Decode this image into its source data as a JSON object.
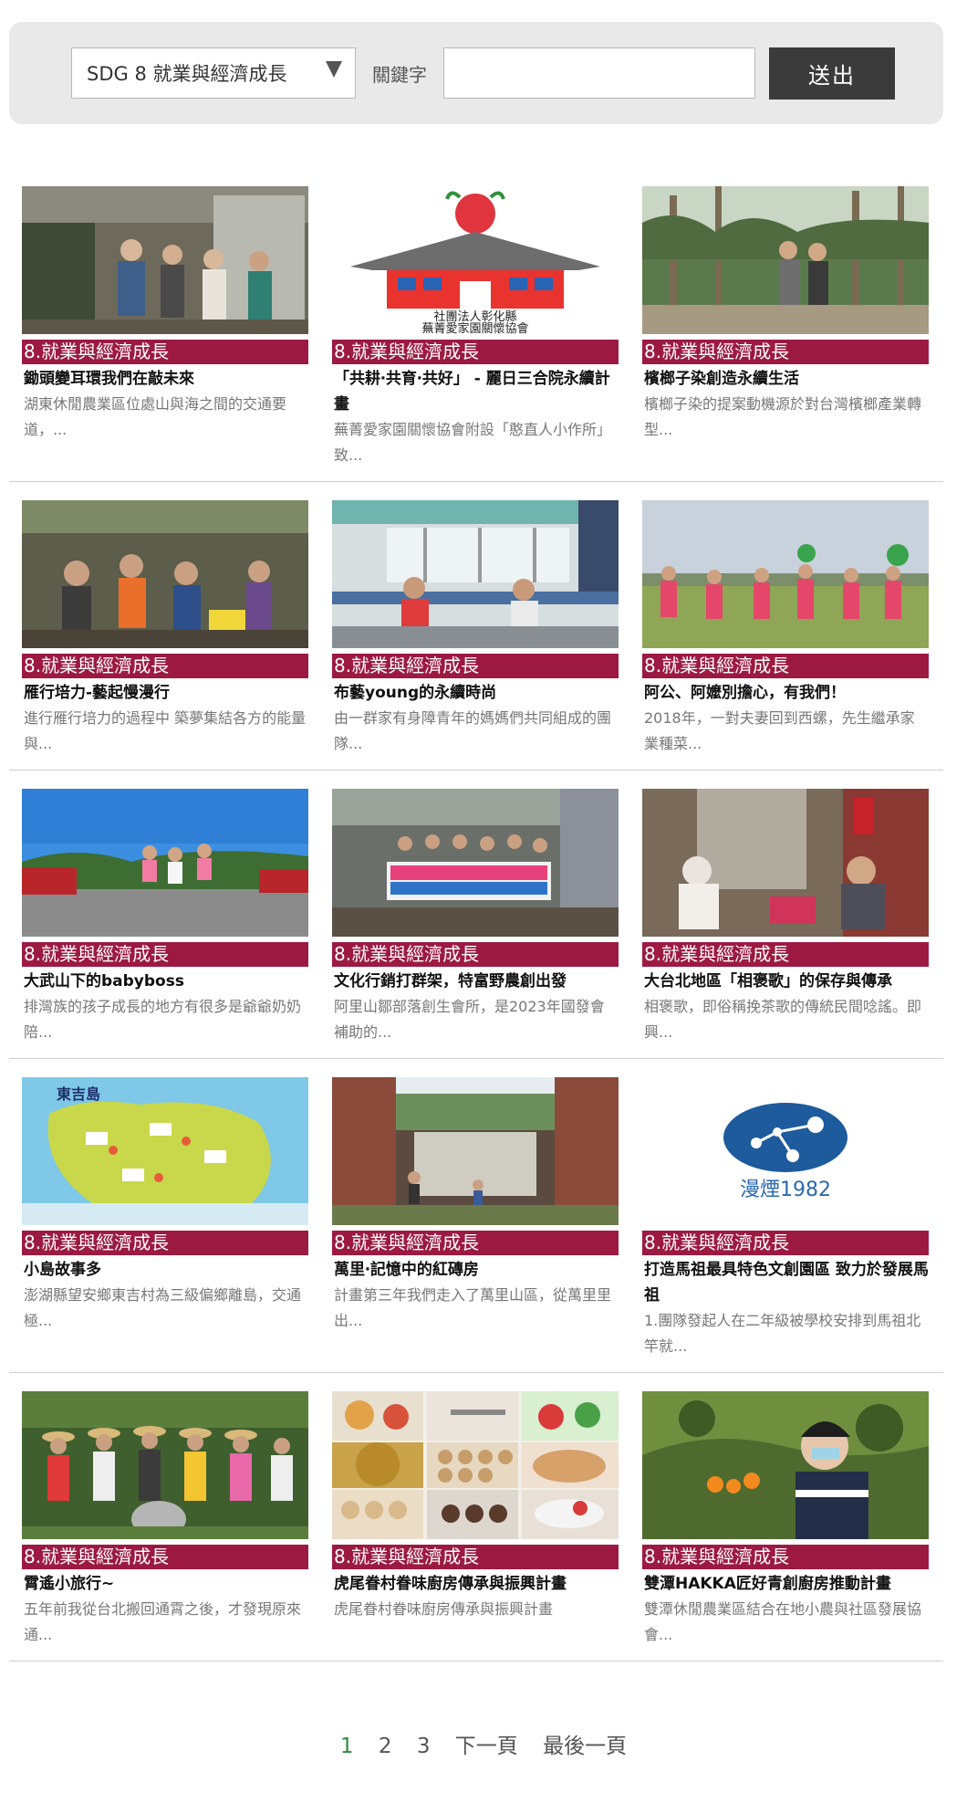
{
  "search": {
    "selected_option": "SDG 8 就業與經濟成長",
    "keyword_label": "關鍵字",
    "keyword_value": "",
    "submit_label": "送出"
  },
  "tag_color": "#9c1a42",
  "rows": [
    [
      {
        "tag": "8.就業與經濟成長",
        "title": "鋤頭變耳環我們在敲未來",
        "desc": "湖東休閒農業區位處山與海之間的交通要道，..."
      },
      {
        "tag": "8.就業與經濟成長",
        "title": "「共耕‧共育‧共好」 - 麗日三合院永續計畫",
        "desc": "蕪菁愛家園關懷協會附設「憨直人小作所」致..."
      },
      {
        "tag": "8.就業與經濟成長",
        "title": "檳榔子染創造永續生活",
        "desc": "檳榔子染的提案動機源於對台灣檳榔產業轉型..."
      }
    ],
    [
      {
        "tag": "8.就業與經濟成長",
        "title": "雁行培力-藝起慢漫行",
        "desc": "進行雁行培力的過程中 築夢集結各方的能量與..."
      },
      {
        "tag": "8.就業與經濟成長",
        "title": "布藝young的永續時尚",
        "desc": "由一群家有身障青年的媽媽們共同組成的團隊..."
      },
      {
        "tag": "8.就業與經濟成長",
        "title": "阿公、阿嬤別擔心，有我們！",
        "desc": "2018年，一對夫妻回到西螺，先生繼承家業種菜..."
      }
    ],
    [
      {
        "tag": "8.就業與經濟成長",
        "title": "大武山下的babyboss",
        "desc": "排灣族的孩子成長的地方有很多是爺爺奶奶陪..."
      },
      {
        "tag": "8.就業與經濟成長",
        "title": "文化行銷打群架，特富野農創出發",
        "desc": "阿里山鄒部落創生會所，是2023年國發會補助的..."
      },
      {
        "tag": "8.就業與經濟成長",
        "title": "大台北地區「相褒歌」的保存與傳承",
        "desc": "相褒歌，即俗稱挽茶歌的傳統民間唸謠。即興..."
      }
    ],
    [
      {
        "tag": "8.就業與經濟成長",
        "title": "小島故事多",
        "desc": "澎湖縣望安鄉東吉村為三級偏鄉離島，交通極..."
      },
      {
        "tag": "8.就業與經濟成長",
        "title": "萬里‧記憶中的紅磚房",
        "desc": "計畫第三年我們走入了萬里山區，從萬里里出..."
      },
      {
        "tag": "8.就業與經濟成長",
        "title": "打造馬祖最具特色文創園區 致力於發展馬祖",
        "desc": "1.團隊發起人在二年級被學校安排到馬祖北竿就..."
      }
    ],
    [
      {
        "tag": "8.就業與經濟成長",
        "title": "霄遙小旅行~",
        "desc": "五年前我從台北搬回通霄之後，才發現原來通..."
      },
      {
        "tag": "8.就業與經濟成長",
        "title": "虎尾眷村眷味廚房傳承與振興計畫",
        "desc": "虎尾眷村眷味廚房傳承與振興計畫"
      },
      {
        "tag": "8.就業與經濟成長",
        "title": "雙潭HAKKA匠好青創廚房推動計畫",
        "desc": "雙潭休閒農業區結合在地小農與社區發展協會..."
      }
    ]
  ],
  "logo_texts": {
    "card_0_1": [
      "社團法人彰化縣",
      "蕪菁愛家園關懷協會"
    ],
    "card_3_0": "東吉島",
    "card_3_2": "漫煙1982"
  },
  "pagination": {
    "pages": [
      "1",
      "2",
      "3"
    ],
    "current": "1",
    "next_label": "下一頁",
    "last_label": "最後一頁"
  }
}
